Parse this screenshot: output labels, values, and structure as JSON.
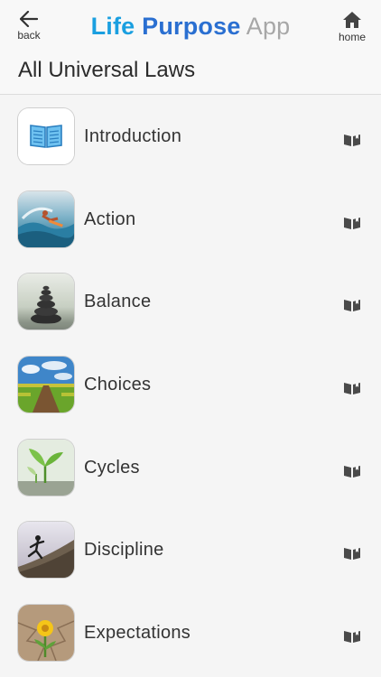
{
  "header": {
    "back_label": "back",
    "home_label": "home",
    "title_part1": "Life ",
    "title_part2": "Purpose",
    "title_part3": " App"
  },
  "page_title": "All Universal Laws",
  "laws": [
    {
      "label": "Introduction"
    },
    {
      "label": "Action"
    },
    {
      "label": "Balance"
    },
    {
      "label": "Choices"
    },
    {
      "label": "Cycles"
    },
    {
      "label": "Discipline"
    },
    {
      "label": "Expectations"
    }
  ],
  "colors": {
    "brand_light": "#1a9fe0",
    "brand_dark": "#2a6fd1",
    "app_grey": "#a7a7a7"
  }
}
